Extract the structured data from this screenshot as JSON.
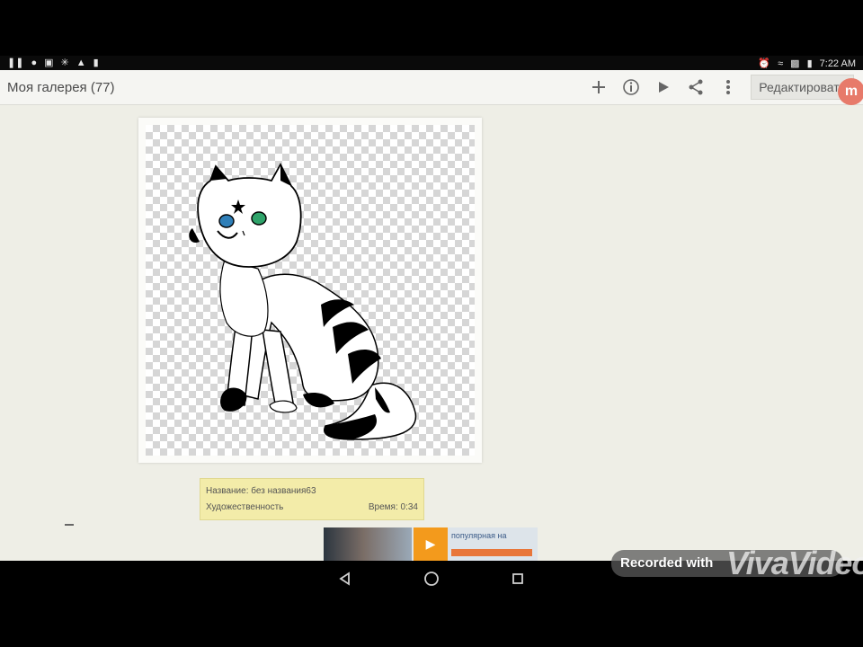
{
  "status_bar": {
    "left_icons": [
      "pause-icon",
      "chat-icon",
      "image-icon",
      "wrench-icon",
      "signal-icon",
      "battery-icon"
    ],
    "right_icons": [
      "alarm-icon",
      "wifi-icon",
      "sim-icon",
      "battery-icon"
    ],
    "time": "7:22 AM"
  },
  "app_bar": {
    "title": "Моя галерея (77)",
    "actions": [
      "plus-icon",
      "info-icon",
      "play-icon",
      "share-icon",
      "more-icon"
    ],
    "edit_label": "Редактировать"
  },
  "artwork": {
    "info_title": "Название: без названия63",
    "info_subtitle": "Художественность",
    "info_time": "Время: 0:34"
  },
  "ad": {
    "logo": "video-icon",
    "text": "популярная на"
  },
  "side_badge": "m",
  "navbar": [
    "back-icon",
    "home-icon",
    "recents-icon"
  ],
  "overlay": {
    "recorded": "Recorded with",
    "watermark": "VivaVideo"
  },
  "colors": {
    "app_bar_bg": "#f5f5f2",
    "content_bg": "#eeeee6",
    "info_card_bg": "#f3eca9",
    "badge": "#e77a6a",
    "ad_logo": "#f39a1c"
  }
}
